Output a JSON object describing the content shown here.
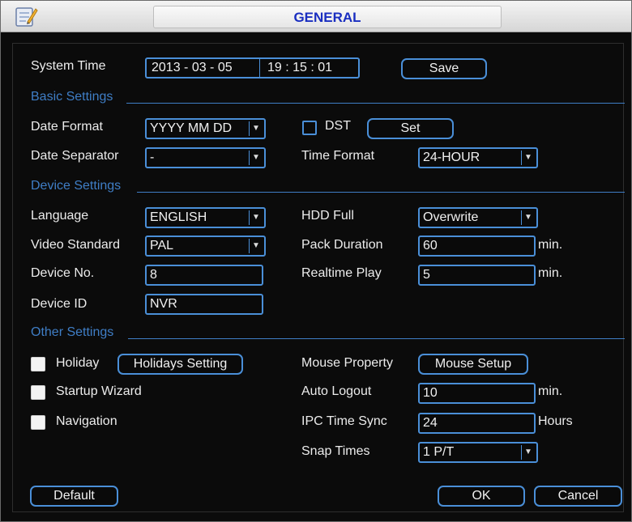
{
  "window": {
    "title": "GENERAL",
    "icon": "settings-pencil-icon"
  },
  "system_time": {
    "label": "System Time",
    "date": "2013 - 03 - 05",
    "time": "19 : 15 : 01",
    "save_label": "Save"
  },
  "basic_settings": {
    "heading": "Basic Settings",
    "date_format": {
      "label": "Date Format",
      "value": "YYYY MM DD"
    },
    "dst": {
      "label": "DST",
      "checked": false,
      "set_label": "Set"
    },
    "date_separator": {
      "label": "Date Separator",
      "value": "-"
    },
    "time_format": {
      "label": "Time Format",
      "value": "24-HOUR"
    }
  },
  "device_settings": {
    "heading": "Device Settings",
    "language": {
      "label": "Language",
      "value": "ENGLISH"
    },
    "hdd_full": {
      "label": "HDD Full",
      "value": "Overwrite"
    },
    "video_standard": {
      "label": "Video Standard",
      "value": "PAL"
    },
    "pack_duration": {
      "label": "Pack Duration",
      "value": "60",
      "unit": "min."
    },
    "device_no": {
      "label": "Device No.",
      "value": "8"
    },
    "realtime_play": {
      "label": "Realtime Play",
      "value": "5",
      "unit": "min."
    },
    "device_id": {
      "label": "Device ID",
      "value": "NVR"
    }
  },
  "other_settings": {
    "heading": "Other Settings",
    "holiday": {
      "label": "Holiday",
      "checked": false,
      "button_label": "Holidays Setting"
    },
    "startup_wizard": {
      "label": "Startup Wizard",
      "checked": false
    },
    "navigation": {
      "label": "Navigation",
      "checked": false
    },
    "mouse_property": {
      "label": "Mouse Property",
      "button_label": "Mouse Setup"
    },
    "auto_logout": {
      "label": "Auto Logout",
      "value": "10",
      "unit": "min."
    },
    "ipc_time_sync": {
      "label": "IPC Time Sync",
      "value": "24",
      "unit": "Hours"
    },
    "snap_times": {
      "label": "Snap Times",
      "value": "1 P/T"
    }
  },
  "footer": {
    "default_label": "Default",
    "ok_label": "OK",
    "cancel_label": "Cancel"
  },
  "colors": {
    "background": "#0b0b0b",
    "accent": "#4a8fd8",
    "section_heading": "#3f7ec6",
    "title_text": "#1a2ec0"
  }
}
